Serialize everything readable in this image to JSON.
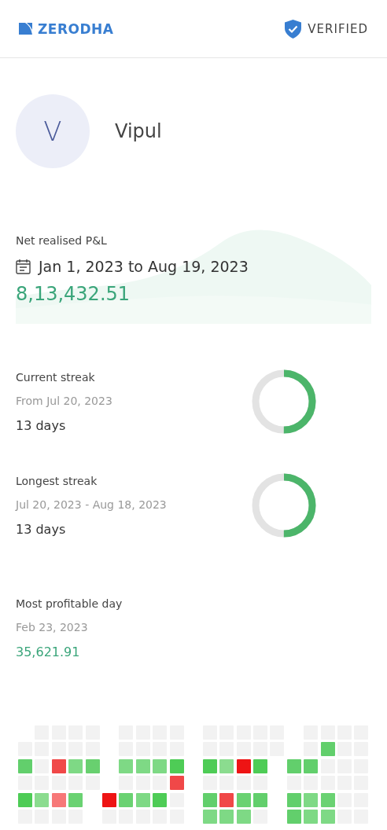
{
  "header": {
    "brand": "ZERODHA",
    "badge": "VERIFIED"
  },
  "profile": {
    "initial": "V",
    "name": "Vipul"
  },
  "pnl": {
    "label": "Net realised P&L",
    "range": "Jan 1, 2023 to Aug 19, 2023",
    "value": "8,13,432.51"
  },
  "streaks": [
    {
      "label": "Current streak",
      "period": "From Jul 20, 2023",
      "value": "13 days",
      "level": 0.5
    },
    {
      "label": "Longest streak",
      "period": "Jul 20, 2023 - Aug 18, 2023",
      "value": "13 days",
      "level": 0.5
    }
  ],
  "profitable_day": {
    "label": "Most profitable day",
    "date": "Feb 23, 2023",
    "value": "35,621.91"
  },
  "heatmap": {
    "months": [
      {
        "rows": [
          {
            "cells": [
              {
                "kind": "blank"
              },
              {
                "kind": "day",
                "color": "#f2f2f2"
              },
              {
                "kind": "day",
                "color": "#f2f2f2"
              },
              {
                "kind": "day",
                "color": "#f2f2f2"
              },
              {
                "kind": "day",
                "color": "#f2f2f2"
              }
            ]
          },
          {
            "cells": [
              {
                "kind": "day",
                "color": "#f2f2f2"
              },
              {
                "kind": "day",
                "color": "#f2f2f2"
              },
              {
                "kind": "day",
                "color": "#f2f2f2"
              },
              {
                "kind": "day",
                "color": "#f2f2f2"
              },
              {
                "kind": "day",
                "color": "#f2f2f2"
              }
            ]
          },
          {
            "cells": [
              {
                "kind": "day",
                "color": "#62cf6c"
              },
              {
                "kind": "day",
                "color": "#f2f2f2"
              },
              {
                "kind": "day",
                "color": "#f04848"
              },
              {
                "kind": "day",
                "color": "#7ed985"
              },
              {
                "kind": "day",
                "color": "#68d06f"
              }
            ]
          },
          {
            "cells": [
              {
                "kind": "day",
                "color": "#f2f2f2"
              },
              {
                "kind": "day",
                "color": "#f2f2f2"
              },
              {
                "kind": "day",
                "color": "#f2f2f2"
              },
              {
                "kind": "day",
                "color": "#f2f2f2"
              },
              {
                "kind": "day",
                "color": "#f2f2f2"
              }
            ]
          },
          {
            "cells": [
              {
                "kind": "day",
                "color": "#4ecc56"
              },
              {
                "kind": "day",
                "color": "#8bdc8f"
              },
              {
                "kind": "day",
                "color": "#f77878"
              },
              {
                "kind": "day",
                "color": "#6ad272"
              },
              {
                "kind": "blank"
              }
            ]
          },
          {
            "cells": [
              {
                "kind": "day",
                "color": "#f2f2f2"
              },
              {
                "kind": "day",
                "color": "#f2f2f2"
              },
              {
                "kind": "day",
                "color": "#f2f2f2"
              },
              {
                "kind": "day",
                "color": "#f2f2f2"
              },
              {
                "kind": "blank"
              }
            ]
          }
        ]
      },
      {
        "rows": [
          {
            "cells": [
              {
                "kind": "blank"
              },
              {
                "kind": "day",
                "color": "#f2f2f2"
              },
              {
                "kind": "day",
                "color": "#f2f2f2"
              },
              {
                "kind": "day",
                "color": "#f2f2f2"
              },
              {
                "kind": "day",
                "color": "#f2f2f2"
              }
            ]
          },
          {
            "cells": [
              {
                "kind": "blank"
              },
              {
                "kind": "day",
                "color": "#f2f2f2"
              },
              {
                "kind": "day",
                "color": "#f2f2f2"
              },
              {
                "kind": "day",
                "color": "#f2f2f2"
              },
              {
                "kind": "day",
                "color": "#f2f2f2"
              }
            ]
          },
          {
            "cells": [
              {
                "kind": "blank"
              },
              {
                "kind": "day",
                "color": "#7ed985"
              },
              {
                "kind": "day",
                "color": "#7ed985"
              },
              {
                "kind": "day",
                "color": "#7ed985"
              },
              {
                "kind": "day",
                "color": "#4ecc56"
              }
            ]
          },
          {
            "cells": [
              {
                "kind": "blank"
              },
              {
                "kind": "day",
                "color": "#f2f2f2"
              },
              {
                "kind": "day",
                "color": "#f2f2f2"
              },
              {
                "kind": "day",
                "color": "#f2f2f2"
              },
              {
                "kind": "day",
                "color": "#f04848"
              }
            ]
          },
          {
            "cells": [
              {
                "kind": "day",
                "color": "#ee1414"
              },
              {
                "kind": "day",
                "color": "#6ad272"
              },
              {
                "kind": "day",
                "color": "#7ed985"
              },
              {
                "kind": "day",
                "color": "#4ecc56"
              },
              {
                "kind": "day",
                "color": "#f2f2f2"
              }
            ]
          },
          {
            "cells": [
              {
                "kind": "day",
                "color": "#f2f2f2"
              },
              {
                "kind": "day",
                "color": "#f2f2f2"
              },
              {
                "kind": "day",
                "color": "#f2f2f2"
              },
              {
                "kind": "day",
                "color": "#f2f2f2"
              },
              {
                "kind": "day",
                "color": "#f2f2f2"
              }
            ]
          }
        ]
      },
      {
        "rows": [
          {
            "cells": [
              {
                "kind": "day",
                "color": "#f2f2f2"
              },
              {
                "kind": "day",
                "color": "#f2f2f2"
              },
              {
                "kind": "day",
                "color": "#f2f2f2"
              },
              {
                "kind": "day",
                "color": "#f2f2f2"
              },
              {
                "kind": "day",
                "color": "#f2f2f2"
              }
            ]
          },
          {
            "cells": [
              {
                "kind": "day",
                "color": "#f2f2f2"
              },
              {
                "kind": "day",
                "color": "#f2f2f2"
              },
              {
                "kind": "day",
                "color": "#f2f2f2"
              },
              {
                "kind": "day",
                "color": "#f2f2f2"
              },
              {
                "kind": "day",
                "color": "#f2f2f2"
              }
            ]
          },
          {
            "cells": [
              {
                "kind": "day",
                "color": "#4ecc56"
              },
              {
                "kind": "day",
                "color": "#8bdc8f"
              },
              {
                "kind": "day",
                "color": "#ee1414"
              },
              {
                "kind": "day",
                "color": "#4ecc56"
              },
              {
                "kind": "blank"
              }
            ]
          },
          {
            "cells": [
              {
                "kind": "day",
                "color": "#f2f2f2"
              },
              {
                "kind": "day",
                "color": "#f2f2f2"
              },
              {
                "kind": "day",
                "color": "#f2f2f2"
              },
              {
                "kind": "day",
                "color": "#f2f2f2"
              },
              {
                "kind": "blank"
              }
            ]
          },
          {
            "cells": [
              {
                "kind": "day",
                "color": "#62cf6c"
              },
              {
                "kind": "day",
                "color": "#f04848"
              },
              {
                "kind": "day",
                "color": "#6ad272"
              },
              {
                "kind": "day",
                "color": "#62cf6c"
              },
              {
                "kind": "blank"
              }
            ]
          },
          {
            "cells": [
              {
                "kind": "day",
                "color": "#7ed985"
              },
              {
                "kind": "day",
                "color": "#7ed985"
              },
              {
                "kind": "day",
                "color": "#7ed985"
              },
              {
                "kind": "day",
                "color": "#f2f2f2"
              },
              {
                "kind": "blank"
              }
            ]
          }
        ]
      },
      {
        "rows": [
          {
            "cells": [
              {
                "kind": "blank"
              },
              {
                "kind": "day",
                "color": "#f2f2f2"
              },
              {
                "kind": "day",
                "color": "#f2f2f2"
              },
              {
                "kind": "day",
                "color": "#f2f2f2"
              },
              {
                "kind": "day",
                "color": "#f2f2f2"
              }
            ]
          },
          {
            "cells": [
              {
                "kind": "blank"
              },
              {
                "kind": "day",
                "color": "#f2f2f2"
              },
              {
                "kind": "day",
                "color": "#62cf6c"
              },
              {
                "kind": "day",
                "color": "#f2f2f2"
              },
              {
                "kind": "day",
                "color": "#f2f2f2"
              }
            ]
          },
          {
            "cells": [
              {
                "kind": "day",
                "color": "#62cf6c"
              },
              {
                "kind": "day",
                "color": "#62cf6c"
              },
              {
                "kind": "day",
                "color": "#f2f2f2"
              },
              {
                "kind": "day",
                "color": "#f2f2f2"
              },
              {
                "kind": "day",
                "color": "#f2f2f2"
              }
            ]
          },
          {
            "cells": [
              {
                "kind": "day",
                "color": "#f2f2f2"
              },
              {
                "kind": "day",
                "color": "#f2f2f2"
              },
              {
                "kind": "day",
                "color": "#f2f2f2"
              },
              {
                "kind": "day",
                "color": "#f2f2f2"
              },
              {
                "kind": "day",
                "color": "#f2f2f2"
              }
            ]
          },
          {
            "cells": [
              {
                "kind": "day",
                "color": "#62cf6c"
              },
              {
                "kind": "day",
                "color": "#7ed985"
              },
              {
                "kind": "day",
                "color": "#6ad272"
              },
              {
                "kind": "day",
                "color": "#f2f2f2"
              },
              {
                "kind": "day",
                "color": "#f2f2f2"
              }
            ]
          },
          {
            "cells": [
              {
                "kind": "day",
                "color": "#62cf6c"
              },
              {
                "kind": "day",
                "color": "#7ed985"
              },
              {
                "kind": "day",
                "color": "#7ed985"
              },
              {
                "kind": "day",
                "color": "#f2f2f2"
              },
              {
                "kind": "day",
                "color": "#f2f2f2"
              }
            ]
          }
        ]
      }
    ]
  }
}
